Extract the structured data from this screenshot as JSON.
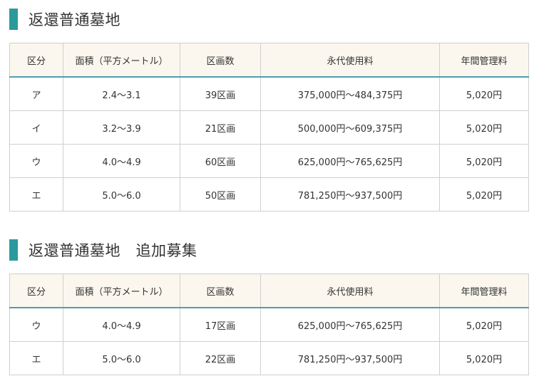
{
  "colors": {
    "accent_bar": "#2a9a9c",
    "header_bg": "#fbf7ee",
    "header_rule": "#4a9fb3",
    "border": "#cfcfcf"
  },
  "sections": [
    {
      "title": "返還普通墓地",
      "headers": [
        "区分",
        "面積（平方メートル）",
        "区画数",
        "永代使用料",
        "年間管理料"
      ],
      "rows": [
        [
          "ア",
          "2.4〜3.1",
          "39区画",
          "375,000円〜484,375円",
          "5,020円"
        ],
        [
          "イ",
          "3.2〜3.9",
          "21区画",
          "500,000円〜609,375円",
          "5,020円"
        ],
        [
          "ウ",
          "4.0〜4.9",
          "60区画",
          "625,000円〜765,625円",
          "5,020円"
        ],
        [
          "エ",
          "5.0〜6.0",
          "50区画",
          "781,250円〜937,500円",
          "5,020円"
        ]
      ]
    },
    {
      "title": "返還普通墓地　追加募集",
      "headers": [
        "区分",
        "面積（平方メートル）",
        "区画数",
        "永代使用料",
        "年間管理料"
      ],
      "rows": [
        [
          "ウ",
          "4.0〜4.9",
          "17区画",
          "625,000円〜765,625円",
          "5,020円"
        ],
        [
          "エ",
          "5.0〜6.0",
          "22区画",
          "781,250円〜937,500円",
          "5,020円"
        ]
      ]
    }
  ]
}
